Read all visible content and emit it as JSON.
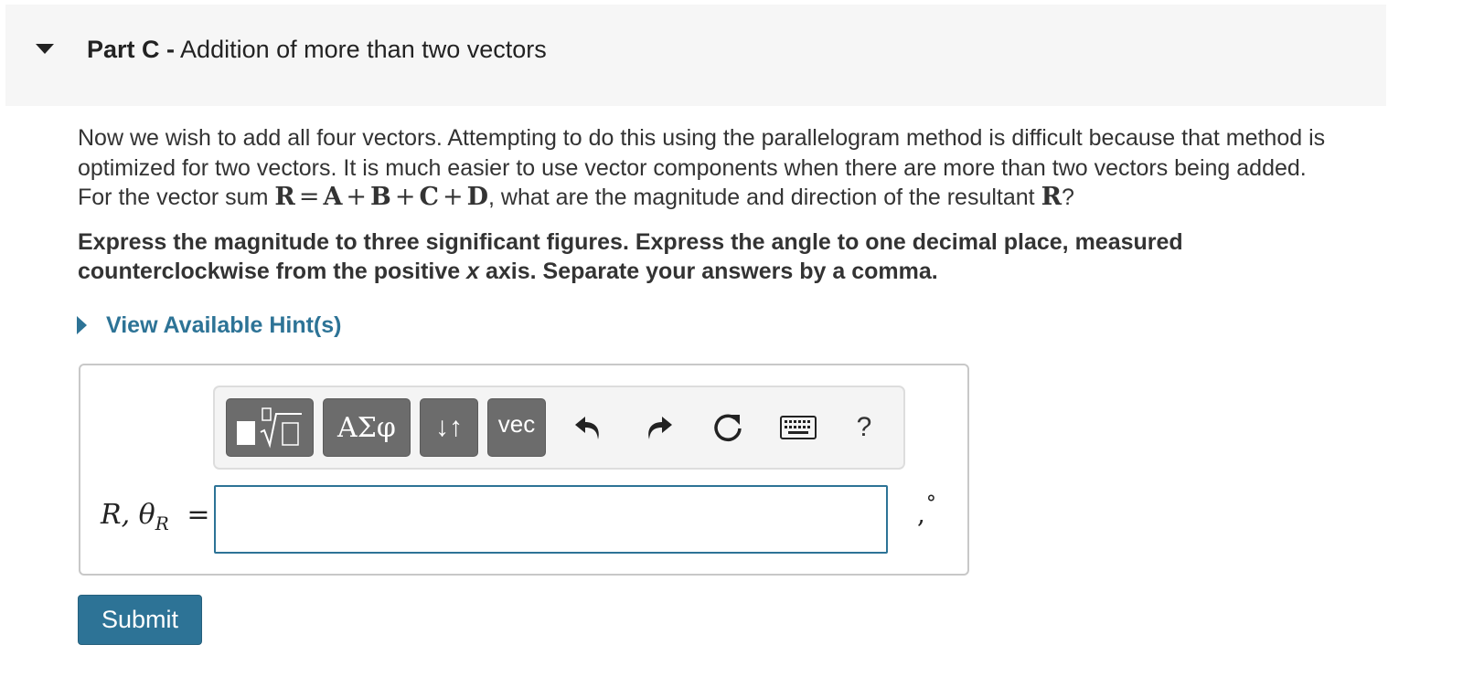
{
  "part": {
    "label": "Part C -",
    "title": "Addition of more than two vectors"
  },
  "problem": {
    "line1": "Now we wish to add all four vectors. Attempting to do this using the parallelogram method is difficult because that method is optimized for two vectors. It is much easier to use vector components when there are more than two vectors being added.",
    "sum_prefix": "For the vector sum",
    "sum_terms": [
      "R",
      "=",
      "A",
      "+",
      "B",
      "+",
      "C",
      "+",
      "D"
    ],
    "sum_suffix": ", what are the magnitude and direction of the resultant",
    "resultant": "R",
    "question_mark": "?"
  },
  "instructions": {
    "part1": "Express the magnitude to three significant figures. Express the angle to one decimal place, measured counterclockwise from the positive",
    "axis": "x",
    "part2": "axis. Separate your answers by a comma."
  },
  "hint": {
    "label": "View Available Hint(s)"
  },
  "toolbar": {
    "templates_icon": "templates-icon",
    "greek_label": "ΑΣφ",
    "arrows_label": "↓↑",
    "vec_label": "vec",
    "undo_icon": "undo-icon",
    "redo_icon": "redo-icon",
    "reset_icon": "reset-icon",
    "keyboard_icon": "keyboard-icon",
    "help_label": "?"
  },
  "answer": {
    "var_r": "R",
    "var_theta": "θ",
    "theta_sub": "R",
    "equals": "=",
    "value": "",
    "unit_comma": ",",
    "unit_degree": "°"
  },
  "submit": {
    "label": "Submit"
  },
  "colors": {
    "accent": "#2d7396",
    "toolbar_button": "#6c6c6c",
    "header_bg": "#f6f6f6"
  }
}
